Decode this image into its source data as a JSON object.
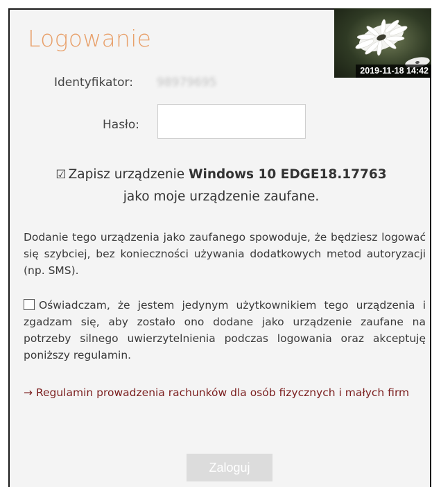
{
  "login": {
    "title": "Logowanie",
    "thumbnail_timestamp": "2019-11-18 14:42",
    "identifier_label": "Identyfikator:",
    "identifier_value": "98979695",
    "password_label": "Hasło:",
    "password_value": "",
    "trust_device": {
      "checked": true,
      "text_before": "Zapisz urządzenie ",
      "device_name": "Windows 10 EDGE18.17763",
      "text_after": "jako moje urządzenie zaufane."
    },
    "info_text": "Dodanie tego urządzenia jako zaufanego spowoduje, że będziesz logować się szybciej, bez konieczności używania dodatkowych metod autoryzacji (np. SMS).",
    "declaration": {
      "checked": false,
      "text": "Oświadczam, że jestem jedynym użytkownikiem tego urządzenia i zgadzam się, aby zostało ono dodane jako urządzenie zaufane na potrzeby silnego uwierzytelnienia podczas logowania oraz akceptuję poniższy regulamin."
    },
    "regulamin_link": "→ Regulamin prowadzenia rachunków dla osób fizycznych i małych firm",
    "login_button": "Zaloguj"
  },
  "colors": {
    "title": "#e8a06a",
    "link": "#7a1d1d",
    "button_disabled": "#dcdcdc"
  },
  "icons": {
    "trust_checkbox": "checked-box-icon",
    "declaration_checkbox": "empty-checkbox-icon",
    "thumbnail": "daisy-flower-image"
  }
}
